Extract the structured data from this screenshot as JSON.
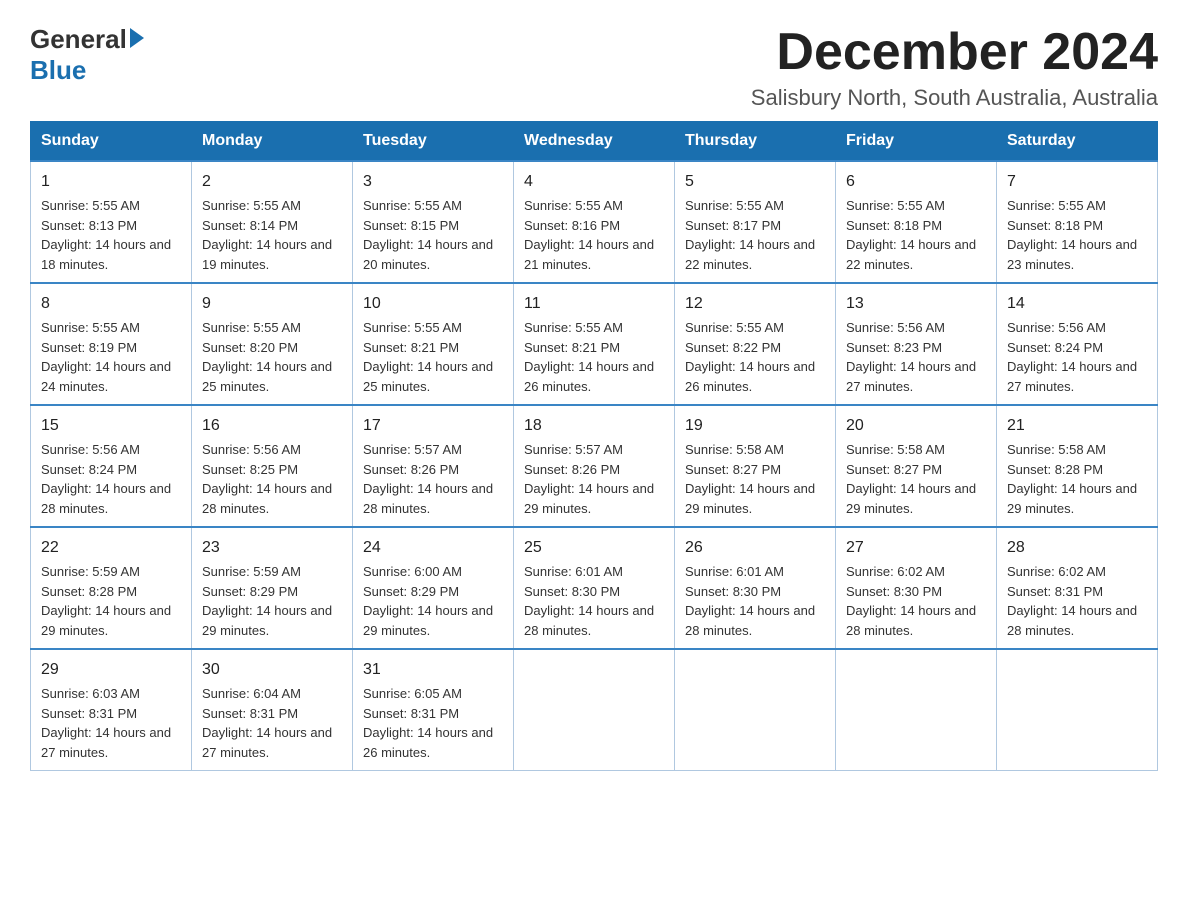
{
  "logo": {
    "general": "General",
    "blue": "Blue"
  },
  "title": "December 2024",
  "location": "Salisbury North, South Australia, Australia",
  "days_of_week": [
    "Sunday",
    "Monday",
    "Tuesday",
    "Wednesday",
    "Thursday",
    "Friday",
    "Saturday"
  ],
  "weeks": [
    [
      {
        "day": "1",
        "sunrise": "5:55 AM",
        "sunset": "8:13 PM",
        "daylight": "14 hours and 18 minutes."
      },
      {
        "day": "2",
        "sunrise": "5:55 AM",
        "sunset": "8:14 PM",
        "daylight": "14 hours and 19 minutes."
      },
      {
        "day": "3",
        "sunrise": "5:55 AM",
        "sunset": "8:15 PM",
        "daylight": "14 hours and 20 minutes."
      },
      {
        "day": "4",
        "sunrise": "5:55 AM",
        "sunset": "8:16 PM",
        "daylight": "14 hours and 21 minutes."
      },
      {
        "day": "5",
        "sunrise": "5:55 AM",
        "sunset": "8:17 PM",
        "daylight": "14 hours and 22 minutes."
      },
      {
        "day": "6",
        "sunrise": "5:55 AM",
        "sunset": "8:18 PM",
        "daylight": "14 hours and 22 minutes."
      },
      {
        "day": "7",
        "sunrise": "5:55 AM",
        "sunset": "8:18 PM",
        "daylight": "14 hours and 23 minutes."
      }
    ],
    [
      {
        "day": "8",
        "sunrise": "5:55 AM",
        "sunset": "8:19 PM",
        "daylight": "14 hours and 24 minutes."
      },
      {
        "day": "9",
        "sunrise": "5:55 AM",
        "sunset": "8:20 PM",
        "daylight": "14 hours and 25 minutes."
      },
      {
        "day": "10",
        "sunrise": "5:55 AM",
        "sunset": "8:21 PM",
        "daylight": "14 hours and 25 minutes."
      },
      {
        "day": "11",
        "sunrise": "5:55 AM",
        "sunset": "8:21 PM",
        "daylight": "14 hours and 26 minutes."
      },
      {
        "day": "12",
        "sunrise": "5:55 AM",
        "sunset": "8:22 PM",
        "daylight": "14 hours and 26 minutes."
      },
      {
        "day": "13",
        "sunrise": "5:56 AM",
        "sunset": "8:23 PM",
        "daylight": "14 hours and 27 minutes."
      },
      {
        "day": "14",
        "sunrise": "5:56 AM",
        "sunset": "8:24 PM",
        "daylight": "14 hours and 27 minutes."
      }
    ],
    [
      {
        "day": "15",
        "sunrise": "5:56 AM",
        "sunset": "8:24 PM",
        "daylight": "14 hours and 28 minutes."
      },
      {
        "day": "16",
        "sunrise": "5:56 AM",
        "sunset": "8:25 PM",
        "daylight": "14 hours and 28 minutes."
      },
      {
        "day": "17",
        "sunrise": "5:57 AM",
        "sunset": "8:26 PM",
        "daylight": "14 hours and 28 minutes."
      },
      {
        "day": "18",
        "sunrise": "5:57 AM",
        "sunset": "8:26 PM",
        "daylight": "14 hours and 29 minutes."
      },
      {
        "day": "19",
        "sunrise": "5:58 AM",
        "sunset": "8:27 PM",
        "daylight": "14 hours and 29 minutes."
      },
      {
        "day": "20",
        "sunrise": "5:58 AM",
        "sunset": "8:27 PM",
        "daylight": "14 hours and 29 minutes."
      },
      {
        "day": "21",
        "sunrise": "5:58 AM",
        "sunset": "8:28 PM",
        "daylight": "14 hours and 29 minutes."
      }
    ],
    [
      {
        "day": "22",
        "sunrise": "5:59 AM",
        "sunset": "8:28 PM",
        "daylight": "14 hours and 29 minutes."
      },
      {
        "day": "23",
        "sunrise": "5:59 AM",
        "sunset": "8:29 PM",
        "daylight": "14 hours and 29 minutes."
      },
      {
        "day": "24",
        "sunrise": "6:00 AM",
        "sunset": "8:29 PM",
        "daylight": "14 hours and 29 minutes."
      },
      {
        "day": "25",
        "sunrise": "6:01 AM",
        "sunset": "8:30 PM",
        "daylight": "14 hours and 28 minutes."
      },
      {
        "day": "26",
        "sunrise": "6:01 AM",
        "sunset": "8:30 PM",
        "daylight": "14 hours and 28 minutes."
      },
      {
        "day": "27",
        "sunrise": "6:02 AM",
        "sunset": "8:30 PM",
        "daylight": "14 hours and 28 minutes."
      },
      {
        "day": "28",
        "sunrise": "6:02 AM",
        "sunset": "8:31 PM",
        "daylight": "14 hours and 28 minutes."
      }
    ],
    [
      {
        "day": "29",
        "sunrise": "6:03 AM",
        "sunset": "8:31 PM",
        "daylight": "14 hours and 27 minutes."
      },
      {
        "day": "30",
        "sunrise": "6:04 AM",
        "sunset": "8:31 PM",
        "daylight": "14 hours and 27 minutes."
      },
      {
        "day": "31",
        "sunrise": "6:05 AM",
        "sunset": "8:31 PM",
        "daylight": "14 hours and 26 minutes."
      },
      null,
      null,
      null,
      null
    ]
  ]
}
